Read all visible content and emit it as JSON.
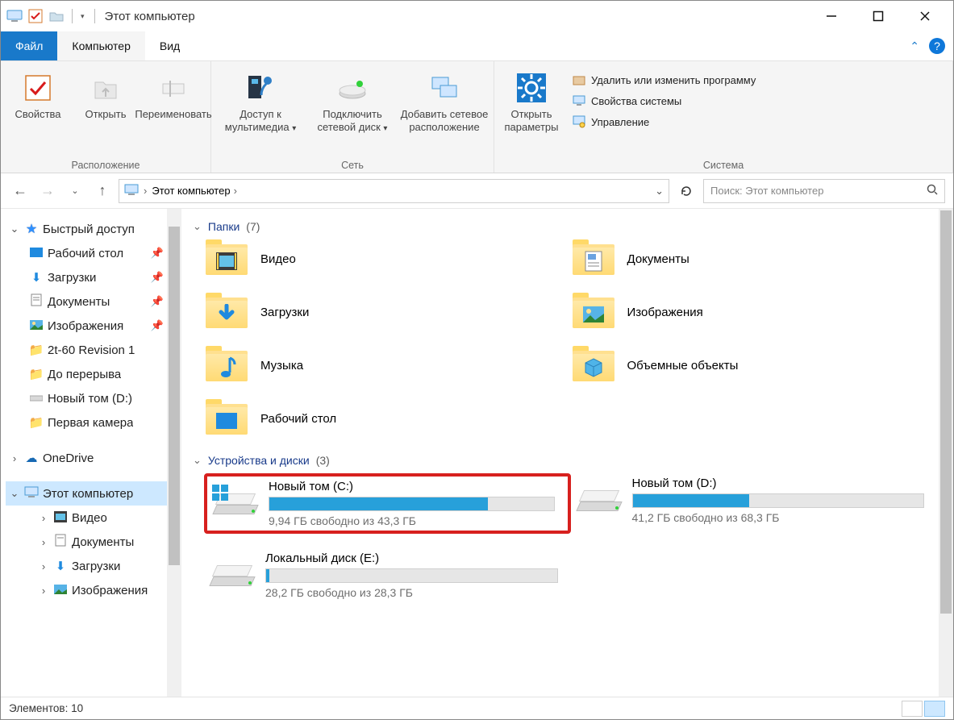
{
  "window": {
    "title": "Этот компьютер"
  },
  "tabs": {
    "file": "Файл",
    "computer": "Компьютер",
    "view": "Вид"
  },
  "ribbon": {
    "location": {
      "properties": "Свойства",
      "open": "Открыть",
      "rename": "Переименовать",
      "label": "Расположение"
    },
    "network": {
      "media": "Доступ к мультимедиа",
      "map_drive": "Подключить сетевой диск",
      "add_net": "Добавить сетевое расположение",
      "label": "Сеть"
    },
    "system": {
      "open_settings": "Открыть параметры",
      "uninstall": "Удалить или изменить программу",
      "sys_props": "Свойства системы",
      "manage": "Управление",
      "label": "Система"
    }
  },
  "address": {
    "crumb": "Этот компьютер"
  },
  "search": {
    "placeholder": "Поиск: Этот компьютер"
  },
  "sidebar": {
    "quick": "Быстрый доступ",
    "items_quick": [
      {
        "label": "Рабочий стол",
        "icon": "desktop"
      },
      {
        "label": "Загрузки",
        "icon": "download"
      },
      {
        "label": "Документы",
        "icon": "doc"
      },
      {
        "label": "Изображения",
        "icon": "img"
      },
      {
        "label": "2t-60 Revision 1",
        "icon": "folder"
      },
      {
        "label": "До перерыва",
        "icon": "folder"
      },
      {
        "label": "Новый том (D:)",
        "icon": "disk"
      },
      {
        "label": "Первая камера",
        "icon": "folder"
      }
    ],
    "onedrive": "OneDrive",
    "thispc": "Этот компьютер",
    "pc_items": [
      {
        "label": "Видео",
        "icon": "video"
      },
      {
        "label": "Документы",
        "icon": "doc"
      },
      {
        "label": "Загрузки",
        "icon": "download"
      },
      {
        "label": "Изображения",
        "icon": "img"
      }
    ]
  },
  "groups": {
    "folders": {
      "title": "Папки",
      "count": "(7)"
    },
    "drives": {
      "title": "Устройства и диски",
      "count": "(3)"
    }
  },
  "folders": [
    {
      "label": "Видео",
      "icon": "video"
    },
    {
      "label": "Документы",
      "icon": "doc"
    },
    {
      "label": "Загрузки",
      "icon": "download"
    },
    {
      "label": "Изображения",
      "icon": "img"
    },
    {
      "label": "Музыка",
      "icon": "music"
    },
    {
      "label": "Объемные объекты",
      "icon": "3d"
    },
    {
      "label": "Рабочий стол",
      "icon": "desktop"
    }
  ],
  "drives": [
    {
      "name": "Новый том (C:)",
      "free": "9,94 ГБ свободно из 43,3 ГБ",
      "fill": 77,
      "os": true,
      "highlight": true
    },
    {
      "name": "Новый том (D:)",
      "free": "41,2 ГБ свободно из 68,3 ГБ",
      "fill": 40,
      "os": false
    },
    {
      "name": "Локальный диск (E:)",
      "free": "28,2 ГБ свободно из 28,3 ГБ",
      "fill": 1,
      "os": false
    }
  ],
  "status": {
    "items": "Элементов: 10"
  }
}
